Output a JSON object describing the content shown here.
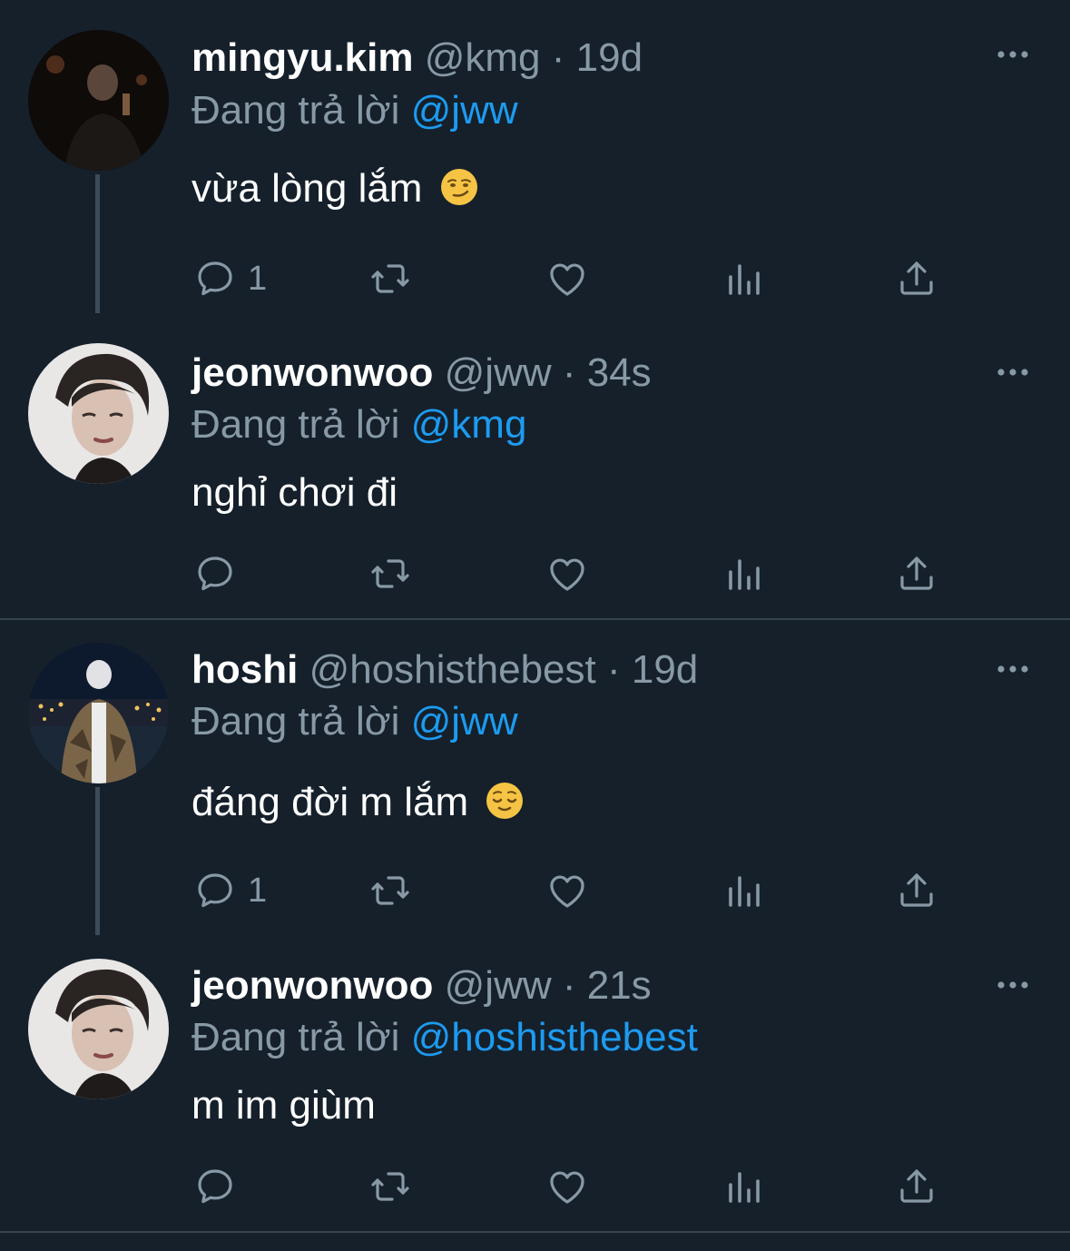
{
  "colors": {
    "background": "#15202b",
    "text_primary": "#ffffff",
    "text_secondary": "#8899a6",
    "mention": "#1d9bf0",
    "divider": "#38444d"
  },
  "tweets": [
    {
      "name": "mingyu.kim",
      "meta": "@kmg · 19d",
      "reply_prefix": "Đang trả lời",
      "reply_to": "@jww",
      "text": "vừa lòng lắm",
      "emoji": "smirking-face",
      "reply_count": "1",
      "icons": [
        "reply-icon",
        "retweet-icon",
        "like-icon",
        "analytics-icon",
        "share-icon",
        "more-icon"
      ]
    },
    {
      "name": "jeonwonwoo",
      "meta": "@jww · 34s",
      "reply_prefix": "Đang trả lời",
      "reply_to": "@kmg",
      "text": "nghỉ chơi đi",
      "reply_count": ""
    },
    {
      "name": "hoshi",
      "meta": "@hoshisthebest · 19d",
      "reply_prefix": "Đang trả lời",
      "reply_to": "@jww",
      "text": "đáng đời m lắm",
      "emoji": "relieved-face",
      "reply_count": "1"
    },
    {
      "name": "jeonwonwoo",
      "meta": "@jww · 21s",
      "reply_prefix": "Đang trả lời",
      "reply_to": "@hoshisthebest",
      "text": "m im giùm",
      "reply_count": ""
    }
  ]
}
